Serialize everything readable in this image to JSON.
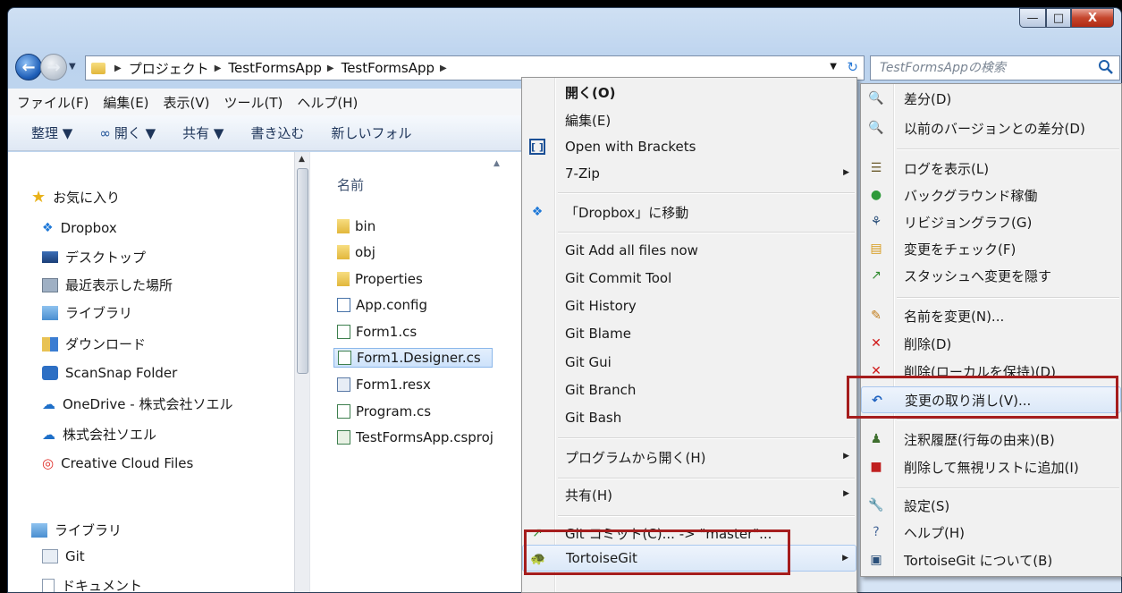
{
  "window": {
    "controls": {
      "minimize": "—",
      "maximize": "□",
      "close": "X"
    }
  },
  "address": {
    "crumbs": [
      "プロジェクト",
      "TestFormsApp",
      "TestFormsApp"
    ],
    "search_placeholder": "TestFormsAppの検索"
  },
  "menubar": [
    "ファイル(F)",
    "編集(E)",
    "表示(V)",
    "ツール(T)",
    "ヘルプ(H)"
  ],
  "toolbar": [
    "整理 ▼",
    "開く ▼",
    "共有 ▼",
    "書き込む",
    "新しいフォル"
  ],
  "navpane": {
    "favorites": "お気に入り",
    "items": [
      "Dropbox",
      "デスクトップ",
      "最近表示した場所",
      "ライブラリ",
      "ダウンロード",
      "ScanSnap Folder",
      "OneDrive - 株式会社ソエル",
      "株式会社ソエル",
      "Creative Cloud Files"
    ],
    "library": "ライブラリ",
    "lib_items": [
      "Git",
      "ドキュメント"
    ]
  },
  "files": {
    "column": "名前",
    "items": [
      "bin",
      "obj",
      "Properties",
      "App.config",
      "Form1.cs",
      "Form1.Designer.cs",
      "Form1.resx",
      "Program.cs",
      "TestFormsApp.csproj"
    ]
  },
  "context_menu": {
    "items": [
      "開く(O)",
      "編集(E)",
      "Open with Brackets",
      "7-Zip",
      "「Dropbox」に移動",
      "Git Add all files now",
      "Git Commit Tool",
      "Git History",
      "Git Blame",
      "Git Gui",
      "Git Branch",
      "Git Bash",
      "プログラムから開く(H)",
      "共有(H)",
      "Git コミット(C)... -> \"master\"...",
      "TortoiseGit"
    ]
  },
  "tortoise_menu": {
    "items": [
      "差分(D)",
      "以前のバージョンとの差分(D)",
      "ログを表示(L)",
      "バックグラウンド稼働",
      "リビジョングラフ(G)",
      "変更をチェック(F)",
      "スタッシュへ変更を隠す",
      "名前を変更(N)...",
      "削除(D)",
      "削除(ローカルを保持)(D)",
      "変更の取り消し(V)...",
      "注釈履歴(行毎の由来)(B)",
      "削除して無視リストに追加(I)",
      "設定(S)",
      "ヘルプ(H)",
      "TortoiseGit について(B)"
    ]
  },
  "colors": {
    "highlight": "#a51d1d",
    "selection": "#cde2fb"
  }
}
